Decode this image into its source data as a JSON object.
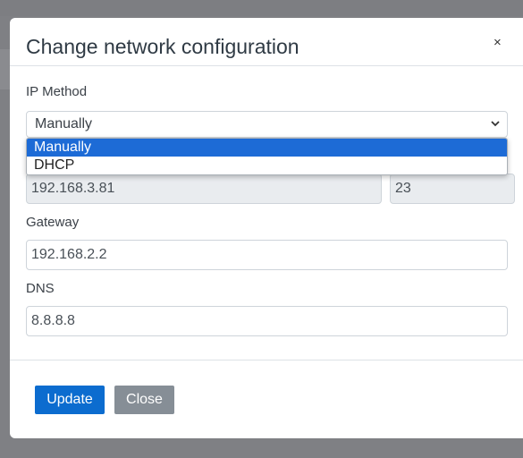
{
  "modal": {
    "title": "Change network configuration",
    "close_symbol": "×"
  },
  "form": {
    "ip_method": {
      "label": "IP Method",
      "value": "Manually",
      "options": [
        "Manually",
        "DHCP"
      ],
      "selected_index": 0
    },
    "ip_address": {
      "value": "192.168.3.81"
    },
    "prefix": {
      "value": "23"
    },
    "gateway": {
      "label": "Gateway",
      "value": "192.168.2.2"
    },
    "dns": {
      "label": "DNS",
      "value": "8.8.8.8"
    }
  },
  "footer": {
    "update_label": "Update",
    "close_label": "Close"
  },
  "colors": {
    "primary": "#0c6ccf",
    "secondary": "#868e96",
    "selected_option": "#1d6bd6"
  },
  "icons": {
    "close": "close-icon",
    "dropdown": "chevron-down-icon"
  }
}
